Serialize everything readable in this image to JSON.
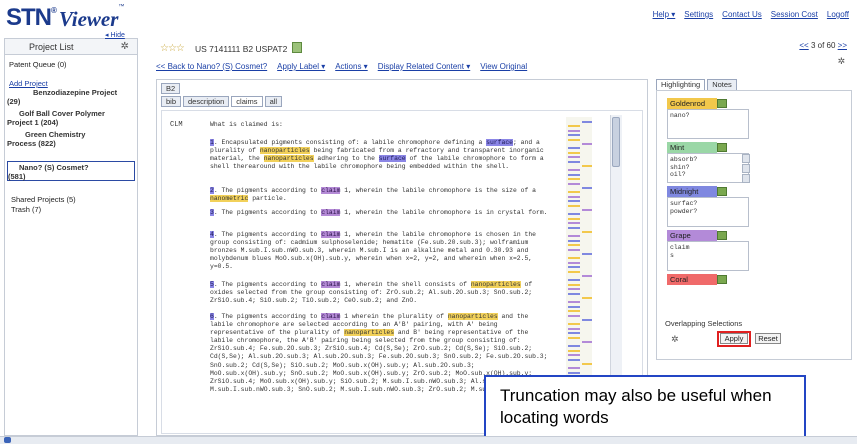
{
  "app": {
    "logo_stn": "STN",
    "logo_sup": "®",
    "logo_viewer": "Viewer",
    "logo_tm": "™"
  },
  "topnav": {
    "help": "Help ▾",
    "settings": "Settings",
    "contact": "Contact Us",
    "session_cost": "Session Cost",
    "logoff": "Logoff"
  },
  "sidebar": {
    "hide": "◂ Hide",
    "title": "Project List",
    "patent_queue": "Patent Queue (0)",
    "add_project": "Add Project",
    "projects": [
      {
        "line1": "Benzodiazepine Project",
        "line2": "(29)"
      },
      {
        "line1": "Golf Ball Cover Polymer",
        "line2": "Project 1 (204)"
      },
      {
        "line1": "Green Chemistry",
        "line2": "Process (822)"
      },
      {
        "line1": "Nano? (S) Cosmet?",
        "line2": "(581)"
      }
    ],
    "shared_projects": "Shared Projects (5)",
    "trash": "Trash (7)"
  },
  "doc_header": {
    "stars": "☆☆☆",
    "doc_id": "US 7141111 B2 USPAT2",
    "pager_prev": "<<",
    "pager_text": "3 of 60",
    "pager_next": ">>"
  },
  "actions": {
    "back": "<< Back to Nano? (S) Cosmet?",
    "apply_label": "Apply Label ▾",
    "actions": "Actions ▾",
    "display_related": "Display Related Content ▾",
    "view_original": "View Original"
  },
  "doc_tabs": {
    "doc_tab": "B2",
    "subtabs": [
      "bib",
      "description",
      "claims",
      "all"
    ]
  },
  "content": {
    "clm_label": "CLM",
    "clm_title": "What is claimed is:",
    "paragraphs": [
      "1. Encapsulated pigments consisting of: a labile chromophore defining a surface; and a plurality of nanoparticles being fabricated from a refractory and transparent inorganic material, the nanoparticles adhering to the surface of the labile chromophore to form a shell therearound with the labile chromophore being embedded within the shell.",
      "2. The pigments according to claim 1, wherein the labile chromophore is the size of a nanometric particle.",
      "3. The pigments according to claim 1, wherein the labile chromophore is in crystal form.",
      "4. The pigments according to claim 1, wherein the labile chromophore is chosen in the group consisting of: cadmium sulphoselenide; hematite (Fe.sub.20.sub.3); wolframium bronzes M.sub.I.sub.nWO.sub.3, wherein M.sub.I is an alkaline metal and 0.30.93 and molybdenum blues MoO.sub.x(OH).sub.y, wherein when x=2, y=2, and wherein when x=2.5, y=0.5.",
      "5. The pigments according to claim 1, wherein the shell consists of nanoparticles of oxides selected from the group consisting of: ZrO.sub.2; Al.sub.2O.sub.3; SnO.sub.2; ZrSiO.sub.4; SiO.sub.2; TiO.sub.2; CeO.sub.2; and ZnO.",
      "6. The pigments according to claim 1 wherein the plurality of nanoparticles and the labile chromophore are selected according to an A'B' pairing, with A' being representative of the plurality of nanoparticles and B' being representative of the labile chromophore, the A'B' pairing being selected from the group consisting of: ZrSiO.sub.4; Fe.sub.2O.sub.3; ZrSiO.sub.4; Cd(S,Se); ZrO.sub.2; Cd(S,Se); SiO.sub.2; Cd(S,Se); Al.sub.2O.sub.3; Al.sub.2O.sub.3; Fe.sub.2O.sub.3; SnO.sub.2; Fe.sub.2O.sub.3; SnO.sub.2; Cd(S,Se); SiO.sub.2; MoO.sub.x(OH).sub.y; Al.sub.2O.sub.3; MoO.sub.x(OH).sub.y; SnO.sub.2; MoO.sub.x(OH).sub.y; ZrO.sub.2; MoO.sub.x(OH).sub.y; ZrSiO.sub.4; MoO.sub.x(OH).sub.y; SiO.sub.2; M.sub.I.sub.nWO.sub.3; Al.sub.2O.sub.3; M.sub.I.sub.nWO.sub.3; SnO.sub.2; M.sub.I.sub.nWO.sub.3; ZrO.sub.2; M.sub.I"
    ]
  },
  "right_panel": {
    "tabs": [
      "Highlighting",
      "Notes"
    ],
    "groups": [
      {
        "label": "Goldenrod",
        "color": "#f2c84b",
        "terms": "nano?"
      },
      {
        "label": "Mint",
        "color": "#9ad7a6",
        "terms": "absorb?\nshin?\noil?"
      },
      {
        "label": "Midnight",
        "color": "#7f88e0",
        "terms": "surfac?\npowder?"
      },
      {
        "label": "Grape",
        "color": "#b38ad8",
        "terms": "claim\ns"
      },
      {
        "label": "Coral",
        "color": "#f06a6a",
        "terms": ""
      }
    ],
    "overlapping": "Overlapping Selections",
    "apply": "Apply",
    "reset": "Reset"
  },
  "callout": {
    "text": "Truncation may also be useful when locating words"
  },
  "colors": {
    "link": "#1a3fa6",
    "highlight_red_box": "#e02020",
    "callout_border": "#2345c4"
  }
}
